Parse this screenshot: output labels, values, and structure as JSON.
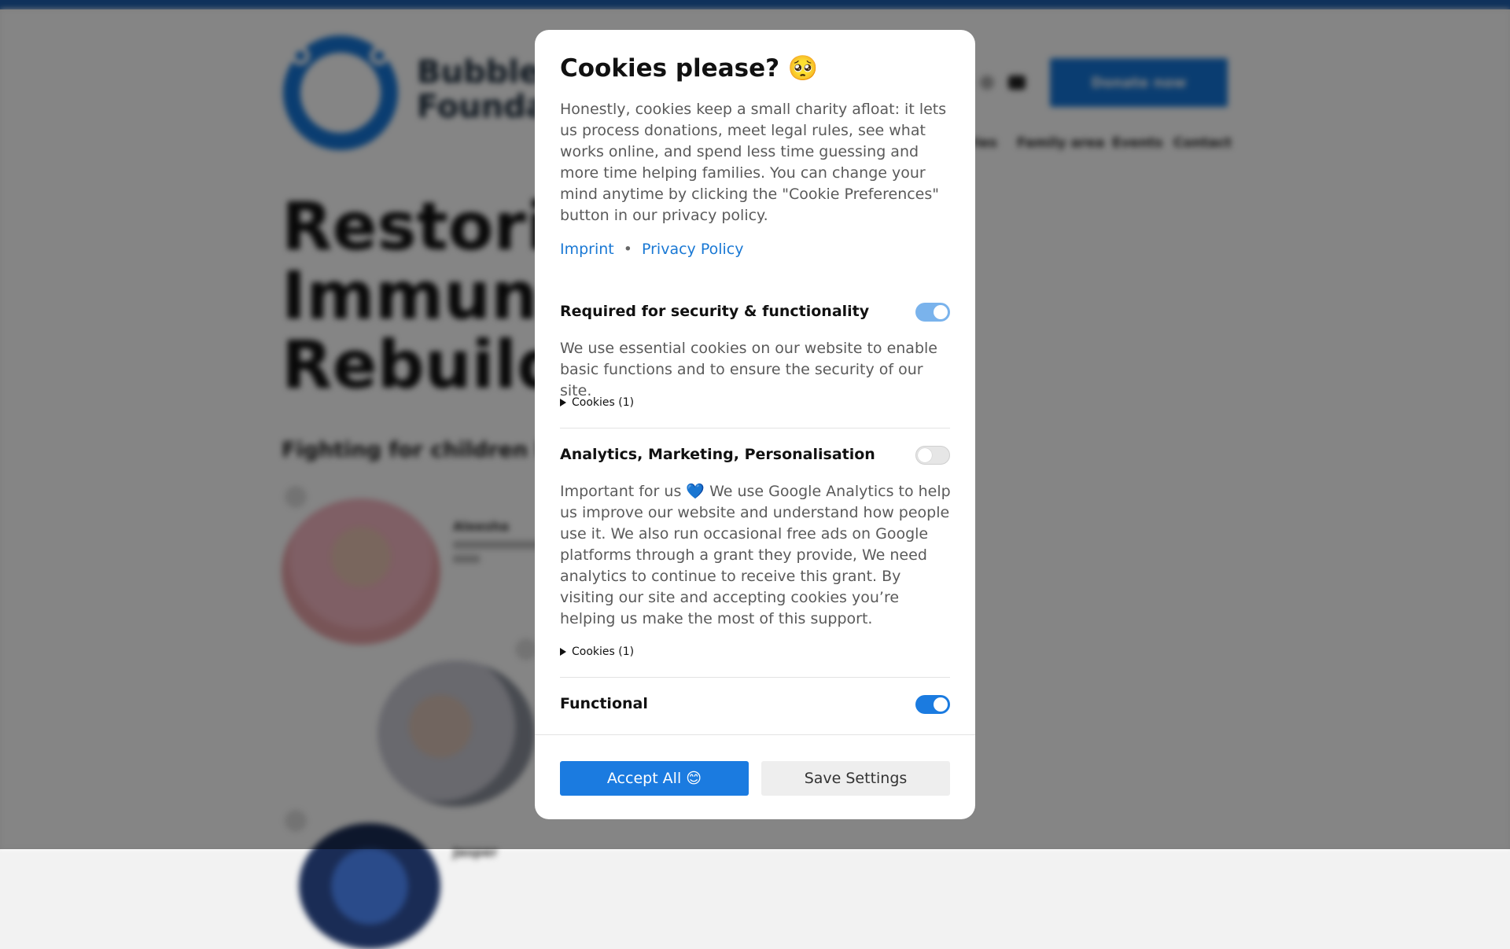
{
  "background": {
    "logo_text": "Bubble\nFoundation",
    "donate_label": "Donate now",
    "nav": [
      "Stories",
      "Family area",
      "Events",
      "Contact"
    ],
    "hero_title": "Restoring\nImmune\nRebuilding",
    "hero_subtitle": "Fighting for children like",
    "children": [
      {
        "name": "Aleesha"
      },
      {
        "name": "Jasper"
      }
    ]
  },
  "modal": {
    "title": "Cookies please? 🥺",
    "intro": "Honestly, cookies keep a small charity afloat: it lets us process donations, meet legal rules, see what works online, and spend less time guessing and more time helping families. You can change your mind anytime by clicking the \"Cookie Preferences\" button in our privacy policy.",
    "links": {
      "imprint": "Imprint",
      "separator": "•",
      "privacy": "Privacy Policy"
    },
    "sections": [
      {
        "title": "Required for security & functionality",
        "description": "We use essential cookies on our website to enable basic functions and to ensure the security of our site.",
        "details_label": "Cookies (1)",
        "enabled": true
      },
      {
        "title": "Analytics, Marketing, Personalisation",
        "description": "Important for us 💙 We use Google Analytics to help us improve our website and understand how people use it. We also run occasional free ads on Google platforms through a grant they provide, We need analytics to continue to receive this grant. By visiting our site and accepting cookies you’re helping us make the most of this support.",
        "details_label": "Cookies (1)",
        "enabled": false
      },
      {
        "title": "Functional",
        "enabled": true
      }
    ],
    "buttons": {
      "accept_all": "Accept All 😊",
      "save_settings": "Save Settings"
    }
  },
  "colors": {
    "accent": "#1b7be0",
    "top_bar": "#1d5fae",
    "link": "#1978d4"
  }
}
